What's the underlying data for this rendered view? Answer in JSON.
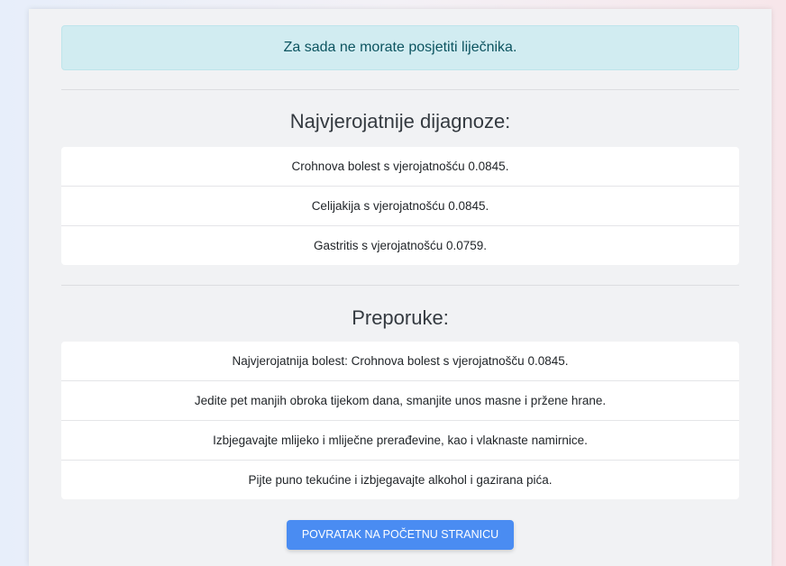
{
  "alert": {
    "message": "Za sada ne morate posjetiti liječnika."
  },
  "diagnoses": {
    "title": "Najvjerojatnije dijagnoze:",
    "items": [
      "Crohnova bolest s vjerojatnošću 0.0845.",
      "Celijakija s vjerojatnošću 0.0845.",
      "Gastritis s vjerojatnošću 0.0759."
    ]
  },
  "recommendations": {
    "title": "Preporuke:",
    "items": [
      "Najvjerojatnija bolest: Crohnova bolest s vjerojatnošču 0.0845.",
      "Jedite pet manjih obroka tijekom dana, smanjite unos masne i pržene hrane.",
      "Izbjegavajte mlijeko i mliječne prerađevine, kao i vlaknaste namirnice.",
      "Pijte puno tekućine i izbjegavajte alkohol i gazirana pića."
    ]
  },
  "back_button": {
    "label": "POVRATAK NA POČETNU STRANICU"
  },
  "colors": {
    "alert_bg": "#d1ecf1",
    "alert_text": "#0c5460",
    "button_bg": "#4a8cf2"
  }
}
